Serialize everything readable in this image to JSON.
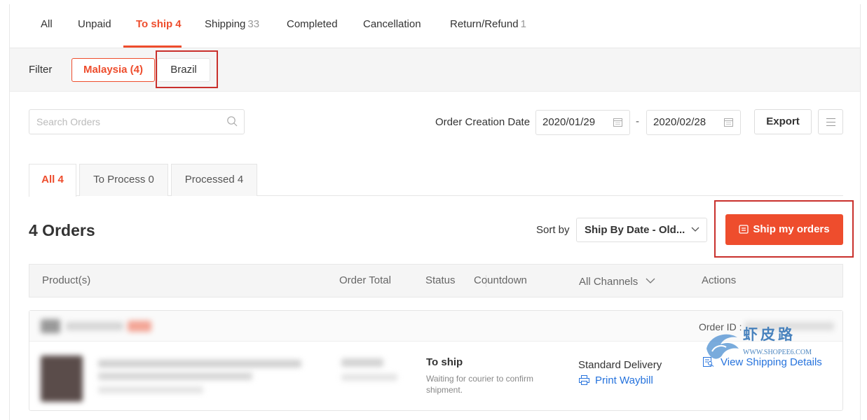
{
  "status_tabs": [
    {
      "label": "All",
      "count": ""
    },
    {
      "label": "Unpaid",
      "count": ""
    },
    {
      "label": "To ship",
      "count": "4"
    },
    {
      "label": "Shipping",
      "count": "33"
    },
    {
      "label": "Completed",
      "count": ""
    },
    {
      "label": "Cancellation",
      "count": ""
    },
    {
      "label": "Return/Refund",
      "count": "1"
    }
  ],
  "active_status_tab": "To ship",
  "filter": {
    "label": "Filter",
    "options": [
      "Malaysia (4)",
      "Brazil"
    ],
    "selected": "Malaysia (4)"
  },
  "search": {
    "placeholder": "Search Orders",
    "value": ""
  },
  "date_range": {
    "label": "Order Creation Date",
    "from": "2020/01/29",
    "separator": "-",
    "to": "2020/02/28"
  },
  "toolbar": {
    "export_label": "Export"
  },
  "sub_tabs": [
    {
      "label": "All 4"
    },
    {
      "label": "To Process 0"
    },
    {
      "label": "Processed 4"
    }
  ],
  "orders_title": "4 Orders",
  "sort": {
    "label": "Sort by",
    "value": "Ship By Date - Old..."
  },
  "ship_button_label": "Ship my orders",
  "table_headers": {
    "product": "Product(s)",
    "order_total": "Order Total",
    "status": "Status",
    "countdown": "Countdown",
    "channels": "All Channels",
    "actions": "Actions"
  },
  "order": {
    "order_id_label": "Order ID :",
    "status": "To ship",
    "status_detail": "Waiting for courier to confirm shipment.",
    "channel": "Standard Delivery",
    "print_label": "Print Waybill",
    "view_label": "View Shipping Details"
  },
  "watermark": {
    "text": "虾皮路",
    "url": "WWW.SHOPEE6.COM"
  },
  "colors": {
    "accent": "#ee4d2d",
    "link": "#2673dd",
    "highlight_box": "#c9302c"
  }
}
